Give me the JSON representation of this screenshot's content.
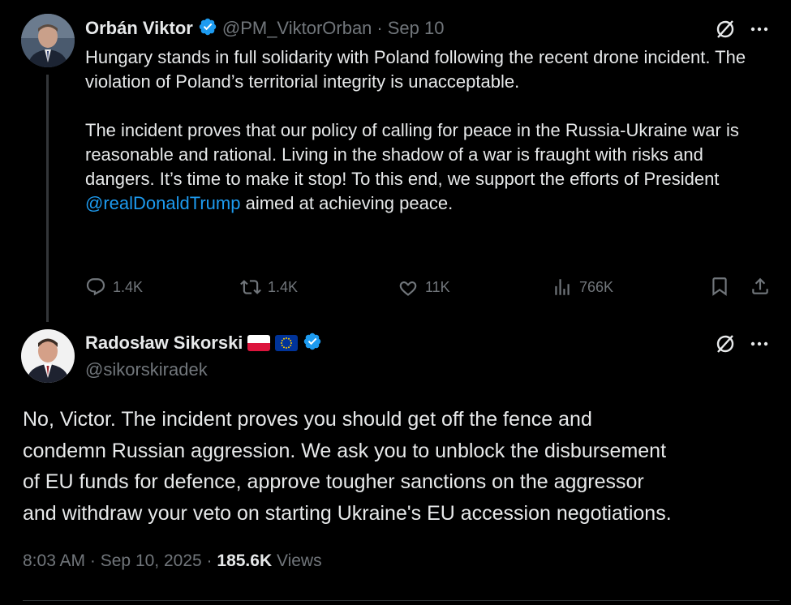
{
  "original_tweet": {
    "author_name": "Orbán Viktor",
    "handle": "@PM_ViktorOrban",
    "date": "Sep 10",
    "separator": "·",
    "paragraph1": "Hungary stands in full solidarity with Poland following the recent drone incident. The violation of Poland’s territorial integrity is unacceptable.",
    "paragraph2_start": "The incident proves that our policy of calling for peace in the Russia-Ukraine war is reasonable and rational. Living in the shadow of a war is fraught with risks and dangers. It’s time to make it stop! To this end, we support the efforts of President ",
    "mention": "@realDonaldTrump",
    "paragraph2_end": " aimed at achieving peace.",
    "actions": {
      "replies": "1.4K",
      "reposts": "1.4K",
      "likes": "11K",
      "views": "766K"
    }
  },
  "reply_tweet": {
    "author_name": "Radosław Sikorski",
    "handle": "@sikorskiradek",
    "flags": [
      "poland-flag",
      "eu-flag"
    ],
    "lines": [
      "No, Victor.  The incident proves you should get off the fence and",
      "condemn Russian aggression.  We ask you to unblock the disbursement",
      "of EU funds for defence, approve tougher sanctions on the aggressor",
      "and withdraw your veto on starting Ukraine's EU accession negotiations."
    ],
    "time": "8:03 AM",
    "date": "Sep 10, 2025",
    "separator": "·",
    "views_count": "185.6K",
    "views_label": "Views"
  },
  "colors": {
    "background": "#000000",
    "text": "#e7e9ea",
    "muted": "#71767b",
    "link": "#1d9bf0",
    "verified": "#1d9bf0"
  },
  "icons": [
    "grok-icon",
    "more-icon",
    "reply-icon",
    "repost-icon",
    "like-icon",
    "views-icon",
    "bookmark-icon",
    "share-icon",
    "verified-icon"
  ]
}
